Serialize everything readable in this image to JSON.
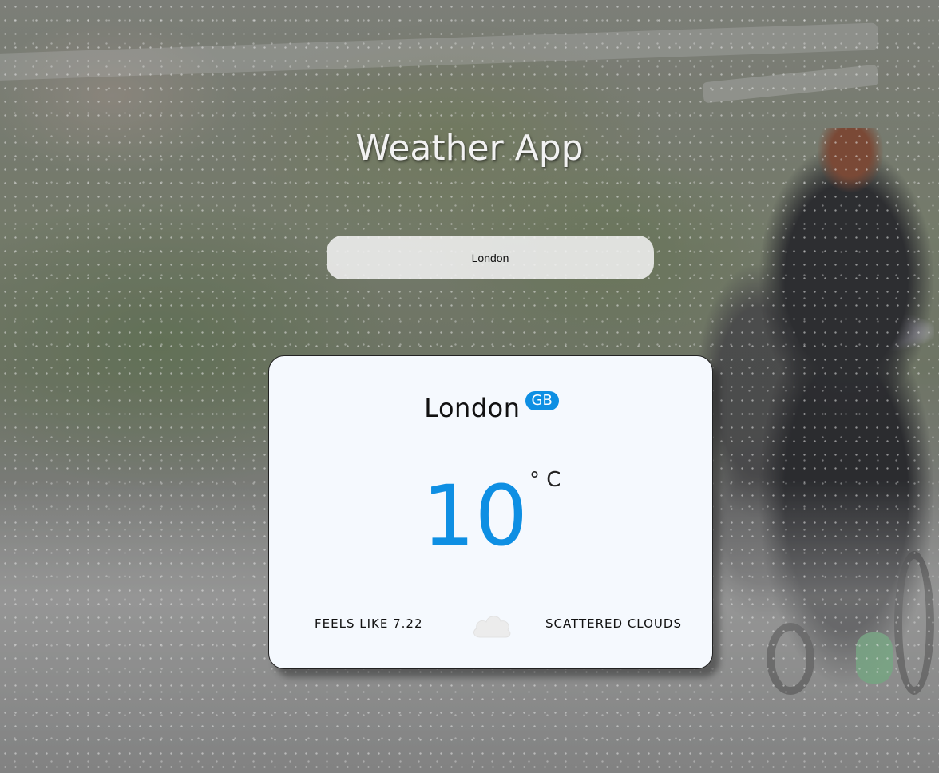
{
  "app": {
    "title": "Weather App"
  },
  "search": {
    "value": "London"
  },
  "weather": {
    "city": "London",
    "country": "GB",
    "temperature": "10",
    "unit": "° C",
    "feels_like": "FEELS LIKE 7.22",
    "description": "SCATTERED CLOUDS",
    "icon": "cloud-icon"
  },
  "colors": {
    "accent": "#0e8fe3",
    "card_background": "#f5f9fe",
    "title_text": "#f2f2f2"
  }
}
